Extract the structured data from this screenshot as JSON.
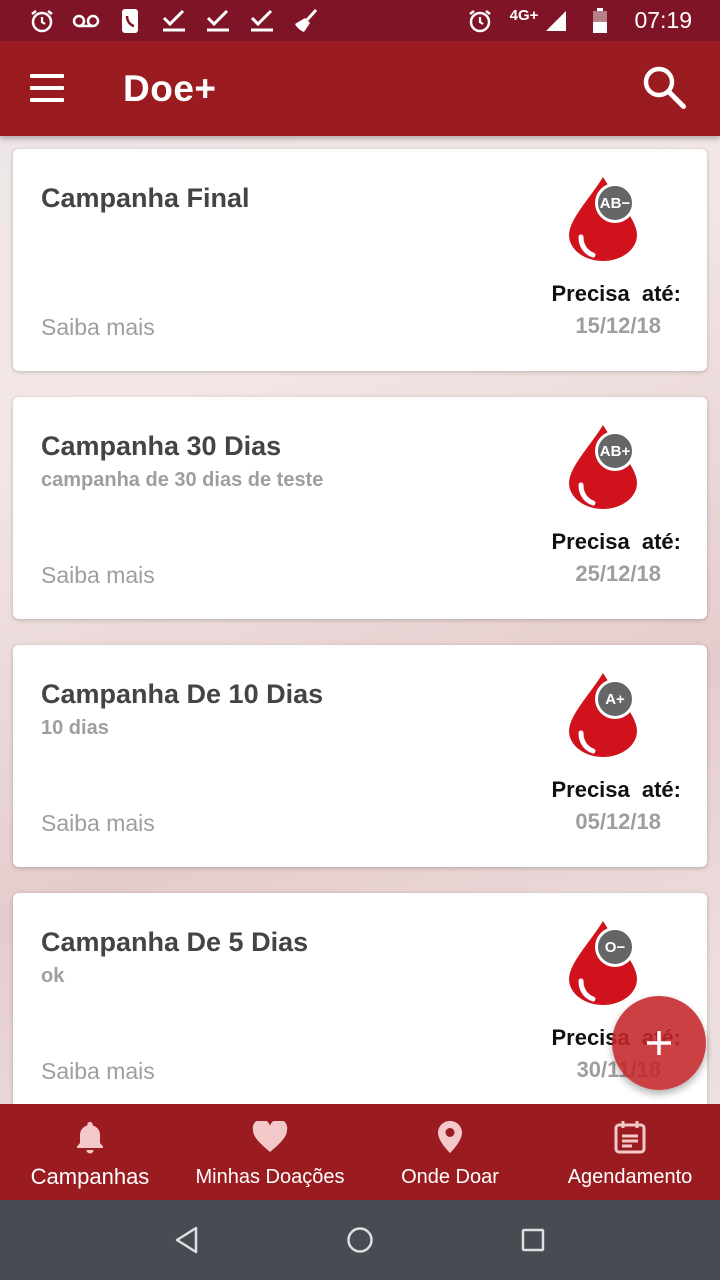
{
  "status_bar": {
    "time": "07:19",
    "network": "4G+",
    "left_icons": [
      "alarm-icon",
      "voicemail-icon",
      "phone-card-icon",
      "check-icon",
      "check-icon",
      "check-icon",
      "broom-icon"
    ],
    "right_icons": [
      "alarm-icon",
      "signal-icon",
      "battery-icon"
    ]
  },
  "app_bar": {
    "title": "Doe+",
    "background": "#9b1c20"
  },
  "campaigns": [
    {
      "title": "Campanha Final",
      "subtitle": "",
      "blood_type": "AB−",
      "needs_label": "Precisa até:",
      "date": "15/12/18",
      "more": "Saiba mais"
    },
    {
      "title": "Campanha 30 Dias",
      "subtitle": "campanha de 30 dias de teste",
      "blood_type": "AB+",
      "needs_label": "Precisa até:",
      "date": "25/12/18",
      "more": "Saiba mais"
    },
    {
      "title": "Campanha De 10 Dias",
      "subtitle": "10 dias",
      "blood_type": "A+",
      "needs_label": "Precisa até:",
      "date": "05/12/18",
      "more": "Saiba mais"
    },
    {
      "title": "Campanha De 5 Dias",
      "subtitle": "ok",
      "blood_type": "O−",
      "needs_label": "Precisa até:",
      "date": "30/11/18",
      "more": "Saiba mais"
    }
  ],
  "fab": {
    "icon": "plus-icon"
  },
  "bottom_nav": {
    "items": [
      {
        "label": "Campanhas",
        "icon": "bell-icon",
        "active": true
      },
      {
        "label": "Minhas Doações",
        "icon": "heart-icon",
        "active": false
      },
      {
        "label": "Onde Doar",
        "icon": "location-pin-icon",
        "active": false
      },
      {
        "label": "Agendamento",
        "icon": "calendar-icon",
        "active": false
      }
    ]
  },
  "colors": {
    "status_bar": "#7e1426",
    "primary": "#9b1c20",
    "drop": "#d0121c",
    "fab": "#c42628",
    "system_nav": "#464c52"
  }
}
